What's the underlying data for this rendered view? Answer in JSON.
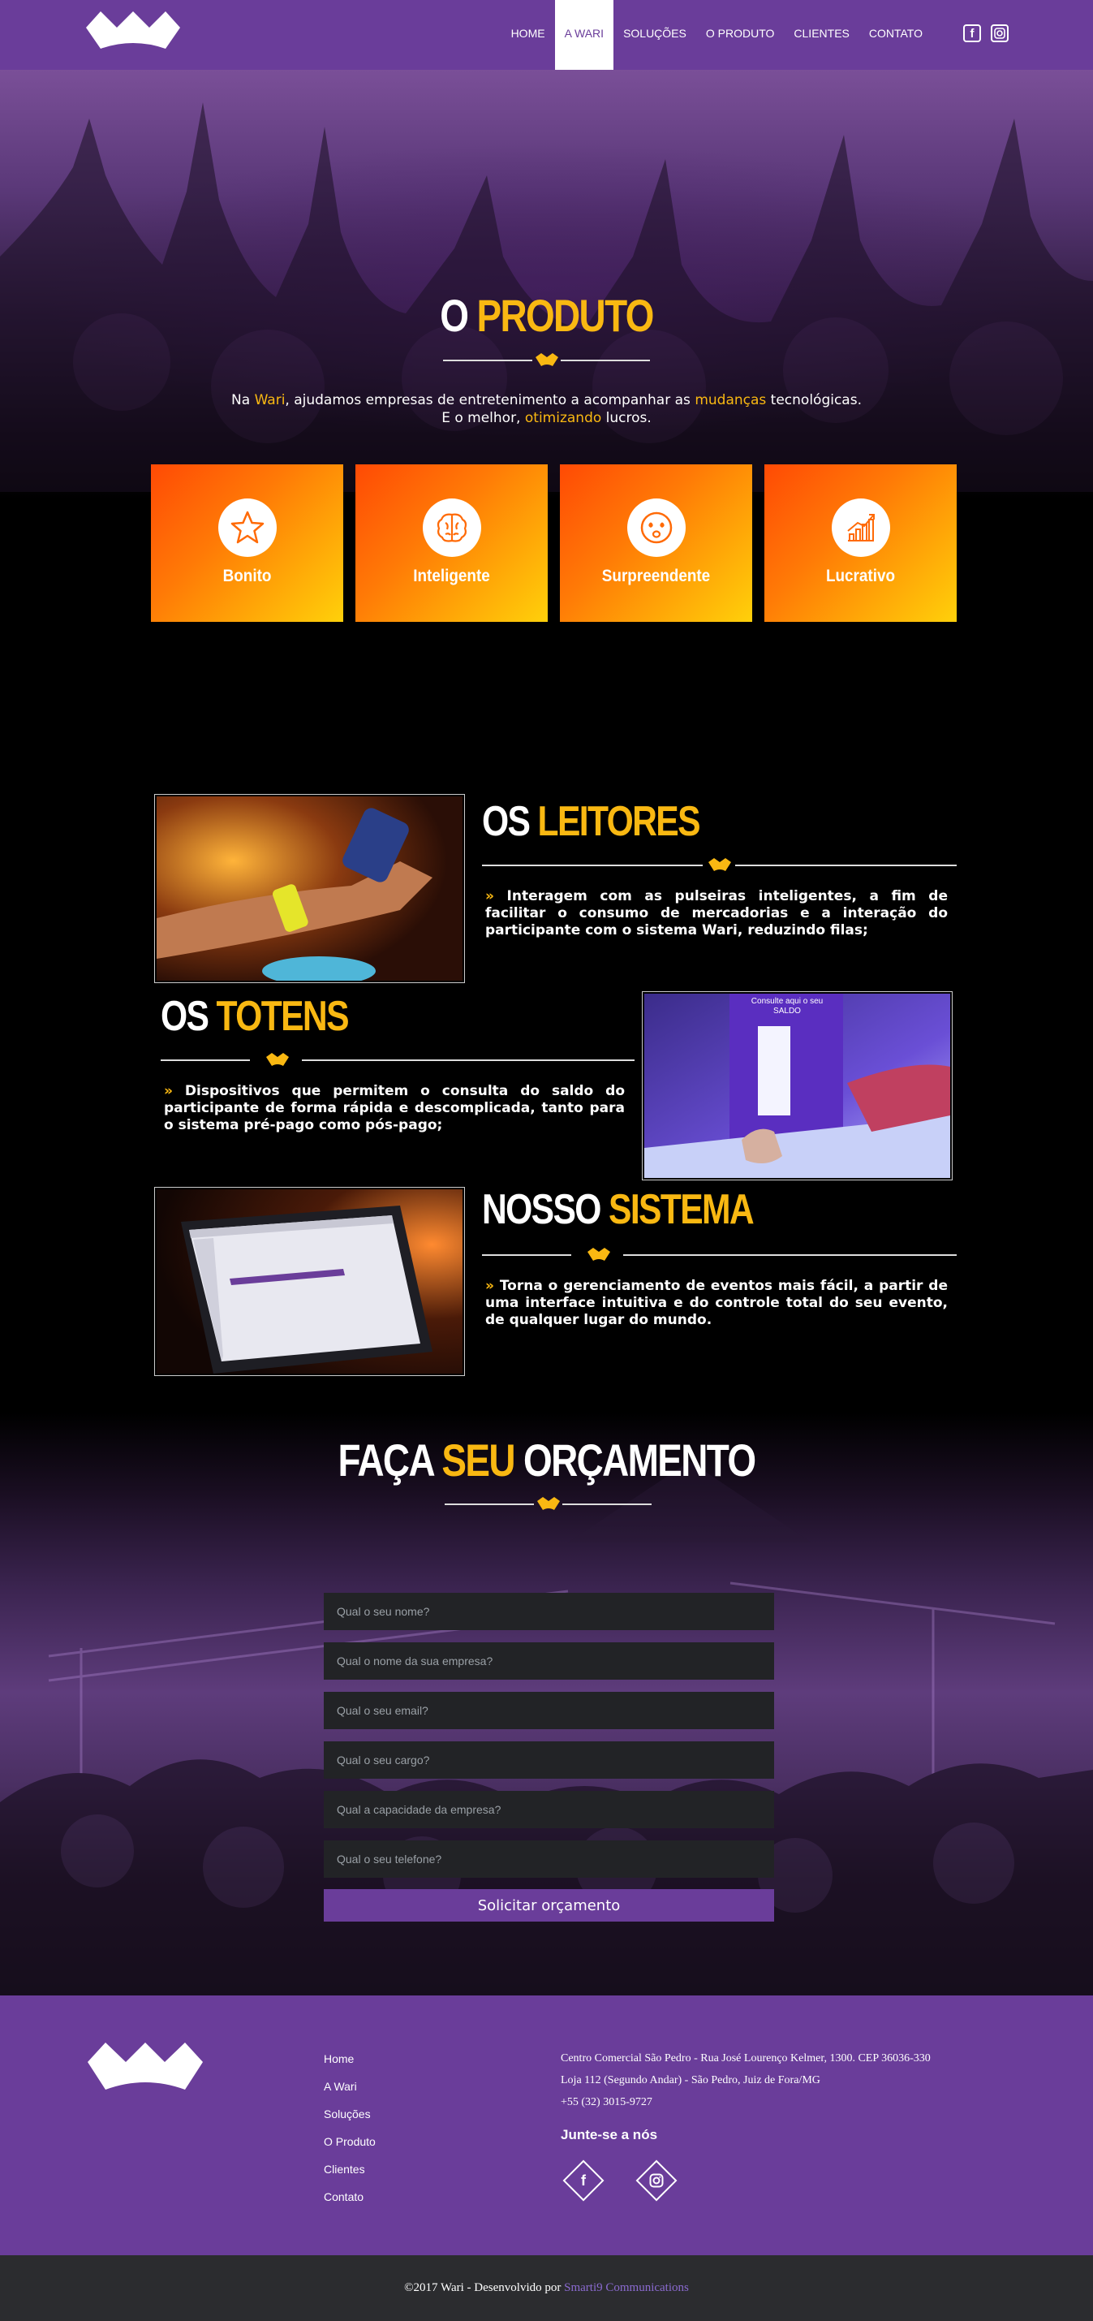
{
  "nav": {
    "items": [
      {
        "label": "HOME"
      },
      {
        "label": "A WARI"
      },
      {
        "label": "SOLUÇÕES"
      },
      {
        "label": "O PRODUTO"
      },
      {
        "label": "CLIENTES"
      },
      {
        "label": "CONTATO"
      }
    ],
    "active_index": 1,
    "social": [
      "facebook-icon",
      "instagram-icon"
    ]
  },
  "hero": {
    "title_white": "O",
    "title_yellow": "PRODUTO",
    "line1_pre": "Na",
    "line1_brand": "Wari",
    "line1_mid": ", ajudamos empresas de entretenimento a acompanhar as",
    "line1_hl": "mudanças",
    "line1_post": "tecnológicas.",
    "line2_pre": "E o melhor,",
    "line2_hl": "otimizando",
    "line2_post": "lucros."
  },
  "features": [
    {
      "label": "Bonito",
      "icon": "star-icon"
    },
    {
      "label": "Inteligente",
      "icon": "brain-icon"
    },
    {
      "label": "Surpreendente",
      "icon": "amazed-face-icon"
    },
    {
      "label": "Lucrativo",
      "icon": "growth-chart-icon"
    }
  ],
  "products": [
    {
      "title_white": "OS",
      "title_yellow": "LEITORES",
      "arrow": "»",
      "text": "Interagem com as pulseiras inteligentes, a fim de facilitar o consumo de mercadorias e a interação do participante com o sistema Wari, reduzindo filas;"
    },
    {
      "title_white": "OS",
      "title_yellow": "TOTENS",
      "arrow": "»",
      "text": "Dispositivos que permitem o consulta do saldo do participante de forma rápida e descomplicada, tanto para o sistema pré-pago como pós-pago;",
      "photo_caption": "Consulte aqui o seu SALDO"
    },
    {
      "title_white": "NOSSO",
      "title_yellow": "SISTEMA",
      "arrow": "»",
      "text": "Torna o gerenciamento de eventos mais fácil, a partir de uma interface intuitiva e do controle total do seu evento, de qualquer lugar do mundo."
    }
  ],
  "quote": {
    "title_a": "FAÇA",
    "title_b": "SEU",
    "title_c": "ORÇAMENTO",
    "placeholders": {
      "name": "Qual o seu nome?",
      "company": "Qual o nome da sua empresa?",
      "email": "Qual o seu email?",
      "role": "Qual o seu cargo?",
      "capacity": "Qual a capacidade da empresa?",
      "phone": "Qual o seu telefone?"
    },
    "submit": "Solicitar orçamento"
  },
  "footer": {
    "links": [
      "Home",
      "A Wari",
      "Soluções",
      "O Produto",
      "Clientes",
      "Contato"
    ],
    "address1": "Centro Comercial São Pedro - Rua José Lourenço Kelmer, 1300. CEP 36036-330",
    "address2": "Loja 112 (Segundo Andar) - São Pedro, Juiz de Fora/MG",
    "phone": "+55 (32) 3015-9727",
    "join": "Junte-se a nós",
    "social": [
      "facebook-icon",
      "instagram-icon"
    ]
  },
  "bottom": {
    "copyright": "©2017 Wari - Desenvolvido por",
    "credit": "Smarti9 Communications"
  },
  "colors": {
    "brand_purple": "#6a3d9a",
    "accent_yellow": "#f9b812",
    "feature_orange": "#ff6a06",
    "footer_dark": "#2b2c2f"
  }
}
